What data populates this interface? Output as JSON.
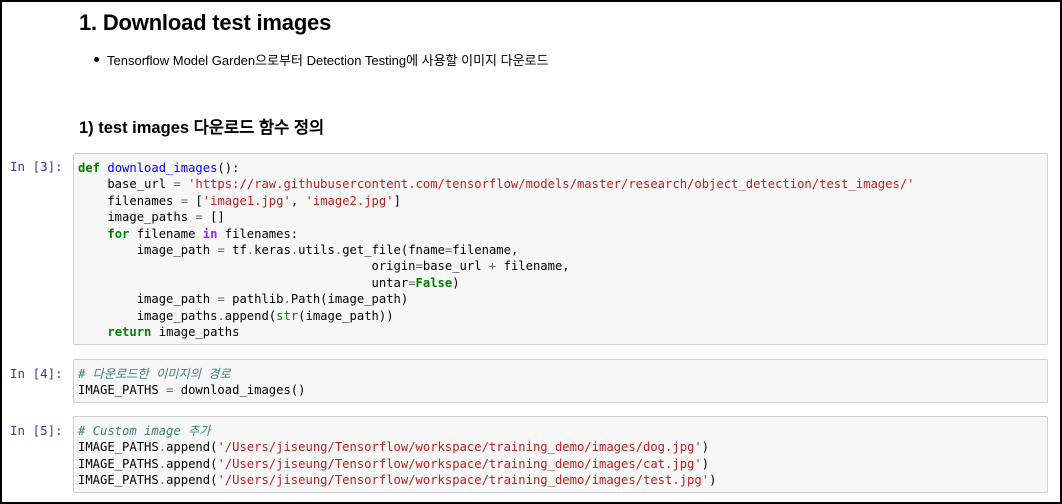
{
  "markdown": {
    "heading1": "1. Download test images",
    "bullet": "Tensorflow Model Garden으로부터 Detection Testing에 사용할 이미지 다운로드",
    "heading2": "1) test images 다운로드 함수 정의"
  },
  "cells": [
    {
      "prompt": "In [3]:",
      "lines": [
        [
          {
            "t": "kw",
            "v": "def"
          },
          {
            "t": "plain",
            "v": " "
          },
          {
            "t": "fn",
            "v": "download_images"
          },
          {
            "t": "plain",
            "v": "():"
          }
        ],
        [
          {
            "t": "plain",
            "v": "    base_url "
          },
          {
            "t": "op2",
            "v": "="
          },
          {
            "t": "plain",
            "v": " "
          },
          {
            "t": "str",
            "v": "'https://raw.githubusercontent.com/tensorflow/models/master/research/object_detection/test_images/'"
          }
        ],
        [
          {
            "t": "plain",
            "v": "    filenames "
          },
          {
            "t": "op2",
            "v": "="
          },
          {
            "t": "plain",
            "v": " ["
          },
          {
            "t": "str",
            "v": "'image1.jpg'"
          },
          {
            "t": "plain",
            "v": ", "
          },
          {
            "t": "str",
            "v": "'image2.jpg'"
          },
          {
            "t": "plain",
            "v": "]"
          }
        ],
        [
          {
            "t": "plain",
            "v": "    image_paths "
          },
          {
            "t": "op2",
            "v": "="
          },
          {
            "t": "plain",
            "v": " []"
          }
        ],
        [
          {
            "t": "plain",
            "v": "    "
          },
          {
            "t": "kw",
            "v": "for"
          },
          {
            "t": "plain",
            "v": " filename "
          },
          {
            "t": "op",
            "v": "in"
          },
          {
            "t": "plain",
            "v": " filenames:"
          }
        ],
        [
          {
            "t": "plain",
            "v": "        image_path "
          },
          {
            "t": "op2",
            "v": "="
          },
          {
            "t": "plain",
            "v": " tf"
          },
          {
            "t": "op2",
            "v": "."
          },
          {
            "t": "plain",
            "v": "keras"
          },
          {
            "t": "op2",
            "v": "."
          },
          {
            "t": "plain",
            "v": "utils"
          },
          {
            "t": "op2",
            "v": "."
          },
          {
            "t": "plain",
            "v": "get_file(fname"
          },
          {
            "t": "op2",
            "v": "="
          },
          {
            "t": "plain",
            "v": "filename,"
          }
        ],
        [
          {
            "t": "plain",
            "v": "                                        origin"
          },
          {
            "t": "op2",
            "v": "="
          },
          {
            "t": "plain",
            "v": "base_url "
          },
          {
            "t": "op2",
            "v": "+"
          },
          {
            "t": "plain",
            "v": " filename,"
          }
        ],
        [
          {
            "t": "plain",
            "v": "                                        untar"
          },
          {
            "t": "op2",
            "v": "="
          },
          {
            "t": "kw",
            "v": "False"
          },
          {
            "t": "plain",
            "v": ")"
          }
        ],
        [
          {
            "t": "plain",
            "v": "        image_path "
          },
          {
            "t": "op2",
            "v": "="
          },
          {
            "t": "plain",
            "v": " pathlib"
          },
          {
            "t": "op2",
            "v": "."
          },
          {
            "t": "plain",
            "v": "Path(image_path)"
          }
        ],
        [
          {
            "t": "plain",
            "v": "        image_paths"
          },
          {
            "t": "op2",
            "v": "."
          },
          {
            "t": "plain",
            "v": "append("
          },
          {
            "t": "bi",
            "v": "str"
          },
          {
            "t": "plain",
            "v": "(image_path))"
          }
        ],
        [
          {
            "t": "plain",
            "v": "    "
          },
          {
            "t": "kw",
            "v": "return"
          },
          {
            "t": "plain",
            "v": " image_paths"
          }
        ]
      ]
    },
    {
      "prompt": "In [4]:",
      "lines": [
        [
          {
            "t": "cm",
            "v": "# 다운로드한 이미지의 경로"
          }
        ],
        [
          {
            "t": "plain",
            "v": "IMAGE_PATHS "
          },
          {
            "t": "op2",
            "v": "="
          },
          {
            "t": "plain",
            "v": " download_images()"
          }
        ]
      ]
    },
    {
      "prompt": "In [5]:",
      "lines": [
        [
          {
            "t": "cm",
            "v": "# Custom image 추가"
          }
        ],
        [
          {
            "t": "plain",
            "v": "IMAGE_PATHS"
          },
          {
            "t": "op2",
            "v": "."
          },
          {
            "t": "plain",
            "v": "append("
          },
          {
            "t": "str",
            "v": "'/Users/jiseung/Tensorflow/workspace/training_demo/images/dog.jpg'"
          },
          {
            "t": "plain",
            "v": ")"
          }
        ],
        [
          {
            "t": "plain",
            "v": "IMAGE_PATHS"
          },
          {
            "t": "op2",
            "v": "."
          },
          {
            "t": "plain",
            "v": "append("
          },
          {
            "t": "str",
            "v": "'/Users/jiseung/Tensorflow/workspace/training_demo/images/cat.jpg'"
          },
          {
            "t": "plain",
            "v": ")"
          }
        ],
        [
          {
            "t": "plain",
            "v": "IMAGE_PATHS"
          },
          {
            "t": "op2",
            "v": "."
          },
          {
            "t": "plain",
            "v": "append("
          },
          {
            "t": "str",
            "v": "'/Users/jiseung/Tensorflow/workspace/training_demo/images/test.jpg'"
          },
          {
            "t": "plain",
            "v": ")"
          }
        ]
      ]
    }
  ]
}
